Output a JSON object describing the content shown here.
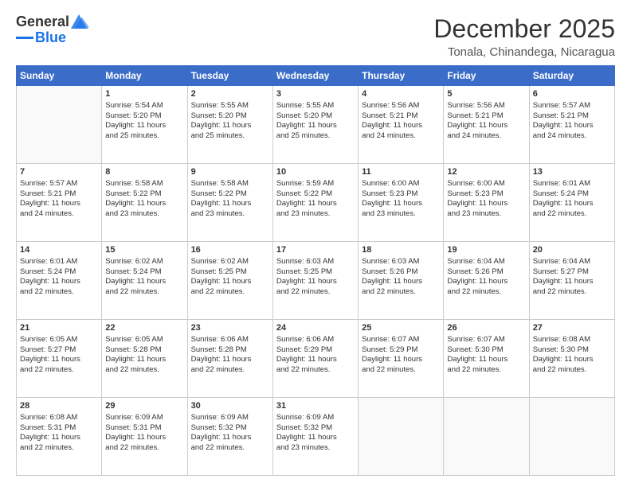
{
  "logo": {
    "general": "General",
    "blue": "Blue"
  },
  "header": {
    "month": "December 2025",
    "location": "Tonala, Chinandega, Nicaragua"
  },
  "weekdays": [
    "Sunday",
    "Monday",
    "Tuesday",
    "Wednesday",
    "Thursday",
    "Friday",
    "Saturday"
  ],
  "weeks": [
    [
      {
        "day": "",
        "content": ""
      },
      {
        "day": "1",
        "content": "Sunrise: 5:54 AM\nSunset: 5:20 PM\nDaylight: 11 hours\nand 25 minutes."
      },
      {
        "day": "2",
        "content": "Sunrise: 5:55 AM\nSunset: 5:20 PM\nDaylight: 11 hours\nand 25 minutes."
      },
      {
        "day": "3",
        "content": "Sunrise: 5:55 AM\nSunset: 5:20 PM\nDaylight: 11 hours\nand 25 minutes."
      },
      {
        "day": "4",
        "content": "Sunrise: 5:56 AM\nSunset: 5:21 PM\nDaylight: 11 hours\nand 24 minutes."
      },
      {
        "day": "5",
        "content": "Sunrise: 5:56 AM\nSunset: 5:21 PM\nDaylight: 11 hours\nand 24 minutes."
      },
      {
        "day": "6",
        "content": "Sunrise: 5:57 AM\nSunset: 5:21 PM\nDaylight: 11 hours\nand 24 minutes."
      }
    ],
    [
      {
        "day": "7",
        "content": "Sunrise: 5:57 AM\nSunset: 5:21 PM\nDaylight: 11 hours\nand 24 minutes."
      },
      {
        "day": "8",
        "content": "Sunrise: 5:58 AM\nSunset: 5:22 PM\nDaylight: 11 hours\nand 23 minutes."
      },
      {
        "day": "9",
        "content": "Sunrise: 5:58 AM\nSunset: 5:22 PM\nDaylight: 11 hours\nand 23 minutes."
      },
      {
        "day": "10",
        "content": "Sunrise: 5:59 AM\nSunset: 5:22 PM\nDaylight: 11 hours\nand 23 minutes."
      },
      {
        "day": "11",
        "content": "Sunrise: 6:00 AM\nSunset: 5:23 PM\nDaylight: 11 hours\nand 23 minutes."
      },
      {
        "day": "12",
        "content": "Sunrise: 6:00 AM\nSunset: 5:23 PM\nDaylight: 11 hours\nand 23 minutes."
      },
      {
        "day": "13",
        "content": "Sunrise: 6:01 AM\nSunset: 5:24 PM\nDaylight: 11 hours\nand 22 minutes."
      }
    ],
    [
      {
        "day": "14",
        "content": "Sunrise: 6:01 AM\nSunset: 5:24 PM\nDaylight: 11 hours\nand 22 minutes."
      },
      {
        "day": "15",
        "content": "Sunrise: 6:02 AM\nSunset: 5:24 PM\nDaylight: 11 hours\nand 22 minutes."
      },
      {
        "day": "16",
        "content": "Sunrise: 6:02 AM\nSunset: 5:25 PM\nDaylight: 11 hours\nand 22 minutes."
      },
      {
        "day": "17",
        "content": "Sunrise: 6:03 AM\nSunset: 5:25 PM\nDaylight: 11 hours\nand 22 minutes."
      },
      {
        "day": "18",
        "content": "Sunrise: 6:03 AM\nSunset: 5:26 PM\nDaylight: 11 hours\nand 22 minutes."
      },
      {
        "day": "19",
        "content": "Sunrise: 6:04 AM\nSunset: 5:26 PM\nDaylight: 11 hours\nand 22 minutes."
      },
      {
        "day": "20",
        "content": "Sunrise: 6:04 AM\nSunset: 5:27 PM\nDaylight: 11 hours\nand 22 minutes."
      }
    ],
    [
      {
        "day": "21",
        "content": "Sunrise: 6:05 AM\nSunset: 5:27 PM\nDaylight: 11 hours\nand 22 minutes."
      },
      {
        "day": "22",
        "content": "Sunrise: 6:05 AM\nSunset: 5:28 PM\nDaylight: 11 hours\nand 22 minutes."
      },
      {
        "day": "23",
        "content": "Sunrise: 6:06 AM\nSunset: 5:28 PM\nDaylight: 11 hours\nand 22 minutes."
      },
      {
        "day": "24",
        "content": "Sunrise: 6:06 AM\nSunset: 5:29 PM\nDaylight: 11 hours\nand 22 minutes."
      },
      {
        "day": "25",
        "content": "Sunrise: 6:07 AM\nSunset: 5:29 PM\nDaylight: 11 hours\nand 22 minutes."
      },
      {
        "day": "26",
        "content": "Sunrise: 6:07 AM\nSunset: 5:30 PM\nDaylight: 11 hours\nand 22 minutes."
      },
      {
        "day": "27",
        "content": "Sunrise: 6:08 AM\nSunset: 5:30 PM\nDaylight: 11 hours\nand 22 minutes."
      }
    ],
    [
      {
        "day": "28",
        "content": "Sunrise: 6:08 AM\nSunset: 5:31 PM\nDaylight: 11 hours\nand 22 minutes."
      },
      {
        "day": "29",
        "content": "Sunrise: 6:09 AM\nSunset: 5:31 PM\nDaylight: 11 hours\nand 22 minutes."
      },
      {
        "day": "30",
        "content": "Sunrise: 6:09 AM\nSunset: 5:32 PM\nDaylight: 11 hours\nand 22 minutes."
      },
      {
        "day": "31",
        "content": "Sunrise: 6:09 AM\nSunset: 5:32 PM\nDaylight: 11 hours\nand 23 minutes."
      },
      {
        "day": "",
        "content": ""
      },
      {
        "day": "",
        "content": ""
      },
      {
        "day": "",
        "content": ""
      }
    ]
  ]
}
